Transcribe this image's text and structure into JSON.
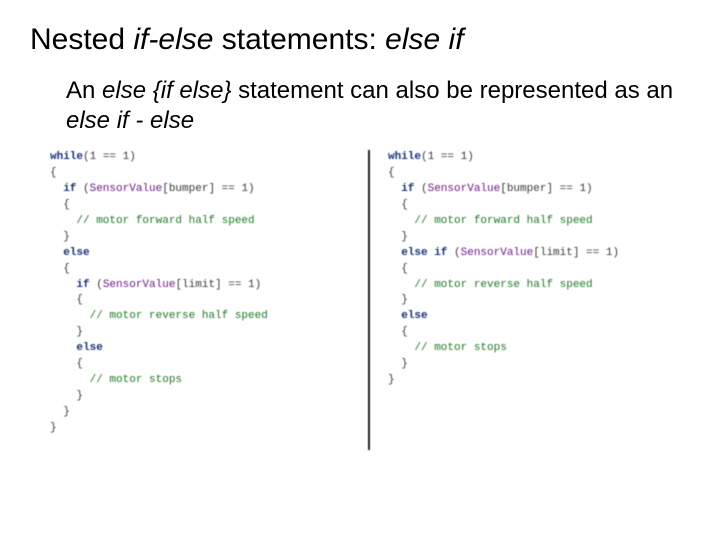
{
  "title": {
    "prefix": "Nested ",
    "italic1": "if-else",
    "middle": " statements: ",
    "italic2": "else if"
  },
  "subtitle": {
    "t1": "An ",
    "i1": "else {if else}",
    "t2": " statement can also be represented as an ",
    "i2": "else if - else"
  },
  "code_left": {
    "l01_kw": "while",
    "l01_rest": "(1 == 1)",
    "l02": "{",
    "l03_pad": "  ",
    "l03_kw": "if",
    "l03_mid": " (",
    "l03_ty": "SensorValue",
    "l03_rest": "[bumper] == 1)",
    "l04": "  {",
    "l05_pad": "    ",
    "l05_cm": "// motor forward half speed",
    "l06": "  }",
    "l07_pad": "  ",
    "l07_kw": "else",
    "l08": "  {",
    "l09_pad": "    ",
    "l09_kw": "if",
    "l09_mid": " (",
    "l09_ty": "SensorValue",
    "l09_rest": "[limit] == 1)",
    "l10": "    {",
    "l11_pad": "      ",
    "l11_cm": "// motor reverse half speed",
    "l12": "    }",
    "l13_pad": "    ",
    "l13_kw": "else",
    "l14": "    {",
    "l15_pad": "      ",
    "l15_cm": "// motor stops",
    "l16": "    }",
    "l17": "  }",
    "l18": "}"
  },
  "code_right": {
    "l01_kw": "while",
    "l01_rest": "(1 == 1)",
    "l02": "{",
    "l03_pad": "  ",
    "l03_kw": "if",
    "l03_mid": " (",
    "l03_ty": "SensorValue",
    "l03_rest": "[bumper] == 1)",
    "l04": "  {",
    "l05_pad": "    ",
    "l05_cm": "// motor forward half speed",
    "l06": "  }",
    "l07_pad": "  ",
    "l07_kw": "else if",
    "l07_mid": " (",
    "l07_ty": "SensorValue",
    "l07_rest": "[limit] == 1)",
    "l08": "  {",
    "l09_pad": "    ",
    "l09_cm": "// motor reverse half speed",
    "l10": "  }",
    "l11_pad": "  ",
    "l11_kw": "else",
    "l12": "  {",
    "l13_pad": "    ",
    "l13_cm": "// motor stops",
    "l14": "  }",
    "l15": "}"
  }
}
